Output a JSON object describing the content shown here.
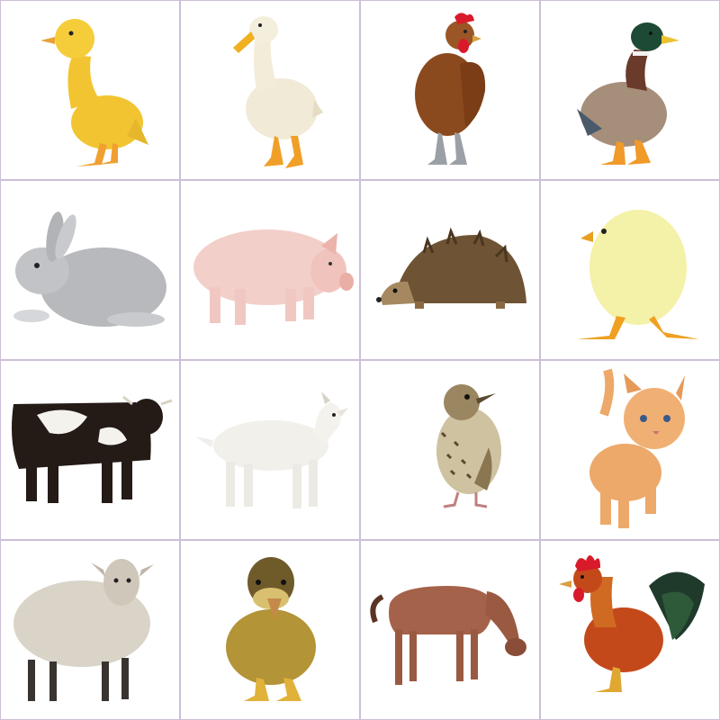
{
  "grid": {
    "border_color": "#cbbfd9",
    "background": "#ffffff",
    "cells": [
      {
        "animal": "duckling-yellow-icon"
      },
      {
        "animal": "white-duck-icon"
      },
      {
        "animal": "hen-icon"
      },
      {
        "animal": "mallard-duck-icon"
      },
      {
        "animal": "rabbit-icon"
      },
      {
        "animal": "pig-icon"
      },
      {
        "animal": "hedgehog-icon"
      },
      {
        "animal": "chick-icon"
      },
      {
        "animal": "cow-icon"
      },
      {
        "animal": "goat-kid-icon"
      },
      {
        "animal": "thrush-icon"
      },
      {
        "animal": "kitten-icon"
      },
      {
        "animal": "sheep-icon"
      },
      {
        "animal": "duckling-brown-icon"
      },
      {
        "animal": "horse-icon"
      },
      {
        "animal": "rooster-icon"
      }
    ]
  }
}
